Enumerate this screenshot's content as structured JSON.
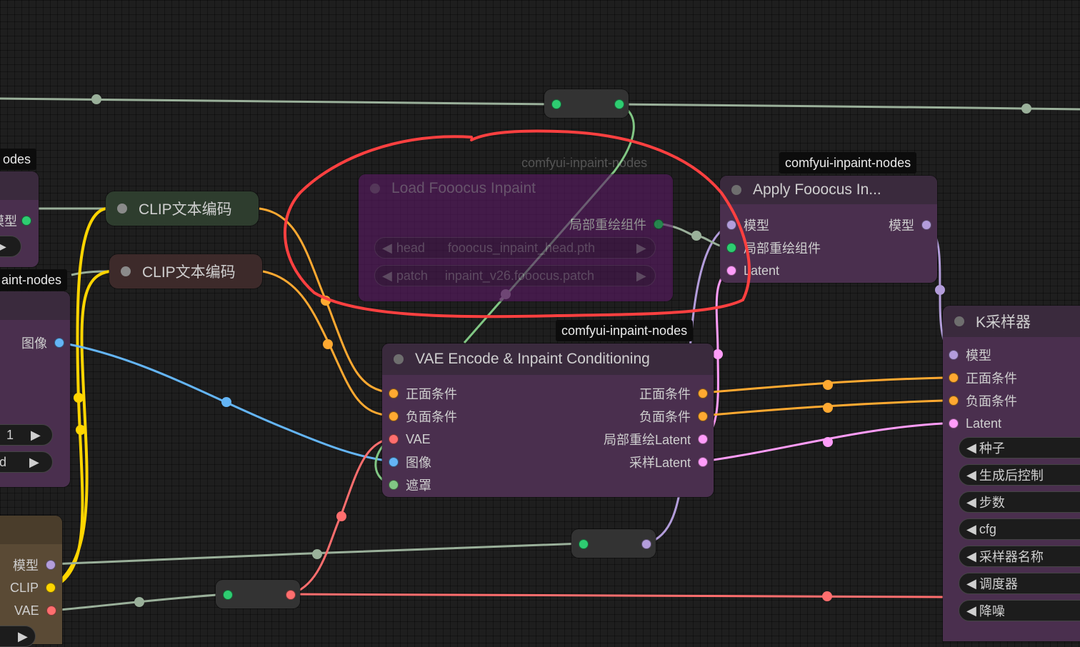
{
  "colors": {
    "model": "#b39ddb",
    "clip": "#ffd500",
    "vae": "#ff6e6e",
    "image": "#64b5f6",
    "mask": "#81c784",
    "conditioning": "#ffa931",
    "latent": "#ff9cf9",
    "inpaint_patch": "#2ecc71",
    "generic_link": "#9ab09a"
  },
  "left_partial_nodes": {
    "top_badge": "odes",
    "mid_badge": "aint-nodes",
    "model_label": "模型",
    "image_label": "图像",
    "widget_value_1": "1",
    "widget_value_2": "ed",
    "checkpoint_outputs": [
      "模型",
      "CLIP",
      "VAE"
    ]
  },
  "clip_nodes": [
    {
      "title": "CLIP文本编码"
    },
    {
      "title": "CLIP文本编码"
    }
  ],
  "load_fooocus": {
    "badge": "comfyui-inpaint-nodes",
    "title": "Load Fooocus Inpaint",
    "output_label": "局部重绘组件",
    "widgets": [
      {
        "name": "head",
        "value": "fooocus_inpaint_head.pth"
      },
      {
        "name": "patch",
        "value": "inpaint_v26.fooocus.patch"
      }
    ]
  },
  "apply_fooocus": {
    "badge": "comfyui-inpaint-nodes",
    "title": "Apply Fooocus In...",
    "inputs": [
      "模型",
      "局部重绘组件",
      "Latent"
    ],
    "outputs": [
      "模型"
    ]
  },
  "vae_encode": {
    "badge": "comfyui-inpaint-nodes",
    "title": "VAE Encode & Inpaint Conditioning",
    "inputs": [
      "正面条件",
      "负面条件",
      "VAE",
      "图像",
      "遮罩"
    ],
    "outputs": [
      "正面条件",
      "负面条件",
      "局部重绘Latent",
      "采样Latent"
    ]
  },
  "ksampler": {
    "title": "K采样器",
    "inputs": [
      "模型",
      "正面条件",
      "负面条件",
      "Latent"
    ],
    "widgets": [
      "种子",
      "生成后控制",
      "步数",
      "cfg",
      "采样器名称",
      "调度器",
      "降噪"
    ]
  },
  "arrows": {
    "left": "◀",
    "right": "▶"
  }
}
